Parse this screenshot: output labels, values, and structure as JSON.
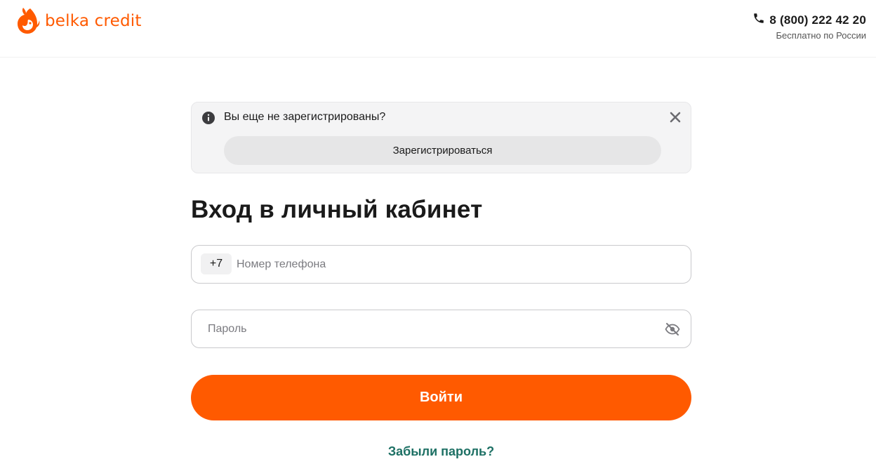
{
  "header": {
    "logo_text": "belka credit",
    "phone_number": "8 (800) 222 42 20",
    "phone_caption": "Бесплатно по России"
  },
  "notice": {
    "text": "Вы еще не зарегистрированы?",
    "register_label": "Зарегистрироваться"
  },
  "login": {
    "title": "Вход в личный кабинет",
    "phone_prefix": "+7",
    "phone_placeholder": "Номер телефона",
    "phone_value": "",
    "password_placeholder": "Пароль",
    "password_value": "",
    "submit_label": "Войти",
    "forgot_label": "Забыли пароль?"
  },
  "icons": {
    "logo": "squirrel-logo-icon",
    "phone": "phone-icon",
    "info": "info-icon",
    "close": "close-icon",
    "password_toggle": "eye-off-icon"
  },
  "colors": {
    "brand": "#ff5a00",
    "link": "#1d7064",
    "notice_bg": "#f4f4f5"
  }
}
